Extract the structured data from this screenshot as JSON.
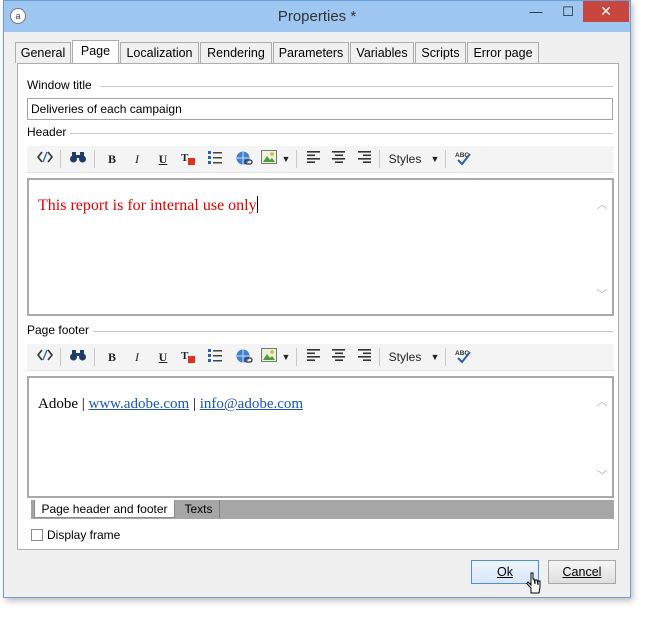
{
  "window": {
    "title": "Properties *",
    "app_icon": "a",
    "controls": {
      "minimize": "—",
      "maximize": "☐",
      "close": "✕"
    }
  },
  "tabs": [
    {
      "label": "General",
      "active": false
    },
    {
      "label": "Page",
      "active": true
    },
    {
      "label": "Localization",
      "active": false
    },
    {
      "label": "Rendering",
      "active": false
    },
    {
      "label": "Parameters",
      "active": false
    },
    {
      "label": "Variables",
      "active": false
    },
    {
      "label": "Scripts",
      "active": false
    },
    {
      "label": "Error page",
      "active": false
    }
  ],
  "window_title_section": {
    "label": "Window title",
    "value": "Deliveries of each campaign"
  },
  "header_section": {
    "label": "Header",
    "content": "This report is for internal use only"
  },
  "footer_section": {
    "label": "Page footer",
    "content_prefix": "Adobe",
    "separator": "|",
    "link1": "www.adobe.com",
    "link2": "info@adobe.com"
  },
  "toolbar": {
    "bold": "B",
    "italic": "I",
    "underline": "U",
    "styles_label": "Styles",
    "spell": "ABC"
  },
  "bottom_tabs": [
    {
      "label": "Page header and footer",
      "active": true
    },
    {
      "label": "Texts",
      "active": false
    }
  ],
  "display_frame": {
    "label": "Display frame",
    "checked": false
  },
  "buttons": {
    "ok": "Ok",
    "cancel": "Cancel"
  },
  "colors": {
    "titlebar": "#9dc6f0",
    "close_button": "#c7463d",
    "header_text": "#e00000",
    "link": "#1a56b8"
  }
}
